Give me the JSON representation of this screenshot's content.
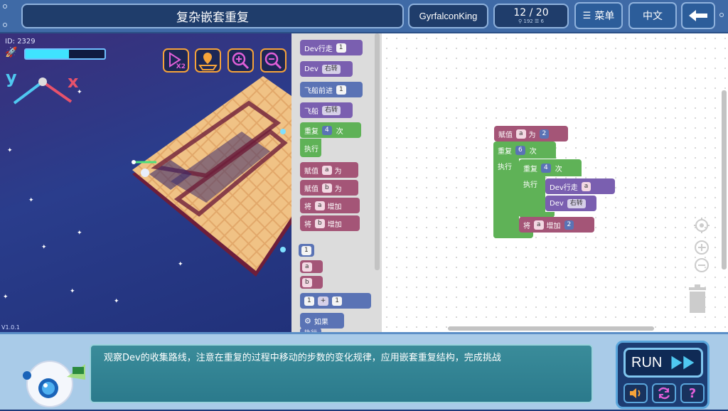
{
  "header": {
    "title": "复杂嵌套重复",
    "username": "GyrfalconKing",
    "level": "12 / 20",
    "level_sub": "⚲ 192   ☰ 6",
    "menu_label": "菜单",
    "lang_label": "中文"
  },
  "game": {
    "id_label": "ID: 2329",
    "energy": 0.55,
    "axis_y": "y",
    "axis_x": "x",
    "version": "V1.0.1",
    "speed_label": "X2"
  },
  "palette": {
    "dev_move": "Dev行走",
    "dev_move_val": "1",
    "dev_label": "Dev",
    "dev_turn": "右转",
    "ship_move": "飞船前进",
    "ship_move_val": "1",
    "ship_label": "飞船",
    "ship_turn": "右转",
    "repeat": "重复",
    "repeat_val": "4",
    "times": "次",
    "exec": "执行",
    "assign": "赋值",
    "var_a": "a",
    "var_b": "b",
    "as": "为",
    "inc_prefix": "将",
    "inc_suffix": "增加",
    "num_1": "1",
    "op": "+",
    "if_label": "如果",
    "exec2": "执行"
  },
  "program": {
    "assign": "赋值",
    "var_a": "a",
    "as": "为",
    "assign_val": "2",
    "repeat": "重复",
    "outer_val": "6",
    "times": "次",
    "exec": "执行",
    "inner_val": "4",
    "dev_move": "Dev行走",
    "dev_label": "Dev",
    "turn": "右转",
    "inc_prefix": "将",
    "inc_suffix": "增加",
    "inc_val": "2"
  },
  "dialog": {
    "hint": "观察Dev的收集路线，注意在重复的过程中移动的步数的变化规律，应用嵌套重复结构，完成挑战",
    "run_label": "RUN"
  },
  "colors": {
    "header": "#3f6aa6",
    "accent": "#8fb2dd",
    "block_purple": "#7a5fb0",
    "block_green": "#5fb257",
    "block_maroon": "#a45577"
  }
}
